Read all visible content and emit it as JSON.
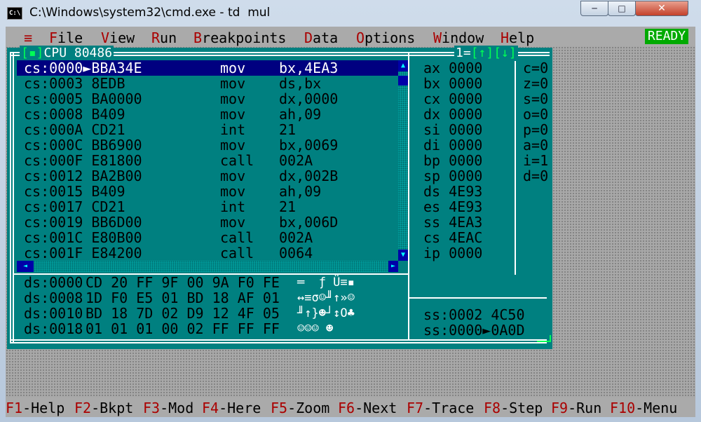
{
  "window": {
    "title": "C:\\Windows\\system32\\cmd.exe - td  mul",
    "icon": "cmd-icon",
    "app_icon_text": "C:\\",
    "min_glyph": "─",
    "max_glyph": "□",
    "close_glyph": "✕"
  },
  "menu": {
    "system": "≡",
    "items": [
      {
        "hot": "F",
        "rest": "ile"
      },
      {
        "hot": "V",
        "rest": "iew"
      },
      {
        "hot": "R",
        "rest": "un"
      },
      {
        "hot": "B",
        "rest": "reakpoints"
      },
      {
        "hot": "D",
        "rest": "ata"
      },
      {
        "hot": "O",
        "rest": "ptions"
      },
      {
        "hot": "W",
        "rest": "indow"
      },
      {
        "hot": "H",
        "rest": "elp"
      }
    ],
    "status": "READY"
  },
  "cpu": {
    "close_box": "[▪]",
    "title": "CPU 80486",
    "window_number": "1",
    "zoom_up": "[↑]",
    "zoom_down": "[↓]",
    "disasm": [
      {
        "addr": "cs:0000►BBA34E",
        "op": "mov",
        "args": "bx,4EA3",
        "selected": true
      },
      {
        "addr": "cs:0003 8EDB",
        "op": "mov",
        "args": "ds,bx"
      },
      {
        "addr": "cs:0005 BA0000",
        "op": "mov",
        "args": "dx,0000"
      },
      {
        "addr": "cs:0008 B409",
        "op": "mov",
        "args": "ah,09"
      },
      {
        "addr": "cs:000A CD21",
        "op": "int",
        "args": "21"
      },
      {
        "addr": "cs:000C BB6900",
        "op": "mov",
        "args": "bx,0069"
      },
      {
        "addr": "cs:000F E81800",
        "op": "call",
        "args": "002A"
      },
      {
        "addr": "cs:0012 BA2B00",
        "op": "mov",
        "args": "dx,002B"
      },
      {
        "addr": "cs:0015 B409",
        "op": "mov",
        "args": "ah,09"
      },
      {
        "addr": "cs:0017 CD21",
        "op": "int",
        "args": "21"
      },
      {
        "addr": "cs:0019 BB6D00",
        "op": "mov",
        "args": "bx,006D"
      },
      {
        "addr": "cs:001C E80B00",
        "op": "call",
        "args": "002A"
      },
      {
        "addr": "cs:001F E84200",
        "op": "call",
        "args": "0064"
      }
    ],
    "registers": [
      {
        "name": "ax",
        "value": "0000"
      },
      {
        "name": "bx",
        "value": "0000"
      },
      {
        "name": "cx",
        "value": "0000"
      },
      {
        "name": "dx",
        "value": "0000"
      },
      {
        "name": "si",
        "value": "0000"
      },
      {
        "name": "di",
        "value": "0000"
      },
      {
        "name": "bp",
        "value": "0000"
      },
      {
        "name": "sp",
        "value": "0000"
      },
      {
        "name": "ds",
        "value": "4E93"
      },
      {
        "name": "es",
        "value": "4E93"
      },
      {
        "name": "ss",
        "value": "4EA3"
      },
      {
        "name": "cs",
        "value": "4EAC"
      },
      {
        "name": "ip",
        "value": "0000"
      }
    ],
    "flags": [
      "c=0",
      "z=0",
      "s=0",
      "o=0",
      "p=0",
      "a=0",
      "i=1",
      "d=0"
    ],
    "dump": [
      {
        "addr": "ds:0000",
        "bytes": "CD 20 FF 9F 00 9A F0 FE",
        "ascii": "═  ƒ Ü≡▪"
      },
      {
        "addr": "ds:0008",
        "bytes": "1D F0 E5 01 BD 18 AF 01",
        "ascii": "↔≡σ☺╜↑»☺"
      },
      {
        "addr": "ds:0010",
        "bytes": "BD 18 7D 02 D9 12 4F 05",
        "ascii": "╜↑}☻┘↕O♣"
      },
      {
        "addr": "ds:0018",
        "bytes": "01 01 01 00 02 FF FF FF",
        "ascii": "☺☺☺ ☻"
      }
    ],
    "stack": [
      {
        "addr": "ss:0002",
        "value": "4C50",
        "marker": " "
      },
      {
        "addr": "ss:0000",
        "value": "0A0D",
        "marker": "►"
      }
    ],
    "scroll": {
      "up": "▲",
      "down": "▼",
      "left": "◄",
      "right": "►"
    }
  },
  "fkeys": [
    {
      "key": "F1",
      "label": "-Help"
    },
    {
      "key": "F2",
      "label": "-Bkpt"
    },
    {
      "key": "F3",
      "label": "-Mod"
    },
    {
      "key": "F4",
      "label": "-Here"
    },
    {
      "key": "F5",
      "label": "-Zoom"
    },
    {
      "key": "F6",
      "label": "-Next"
    },
    {
      "key": "F7",
      "label": "-Trace"
    },
    {
      "key": "F8",
      "label": "-Step"
    },
    {
      "key": "F9",
      "label": "-Run"
    },
    {
      "key": "F10",
      "label": "-Menu"
    }
  ]
}
